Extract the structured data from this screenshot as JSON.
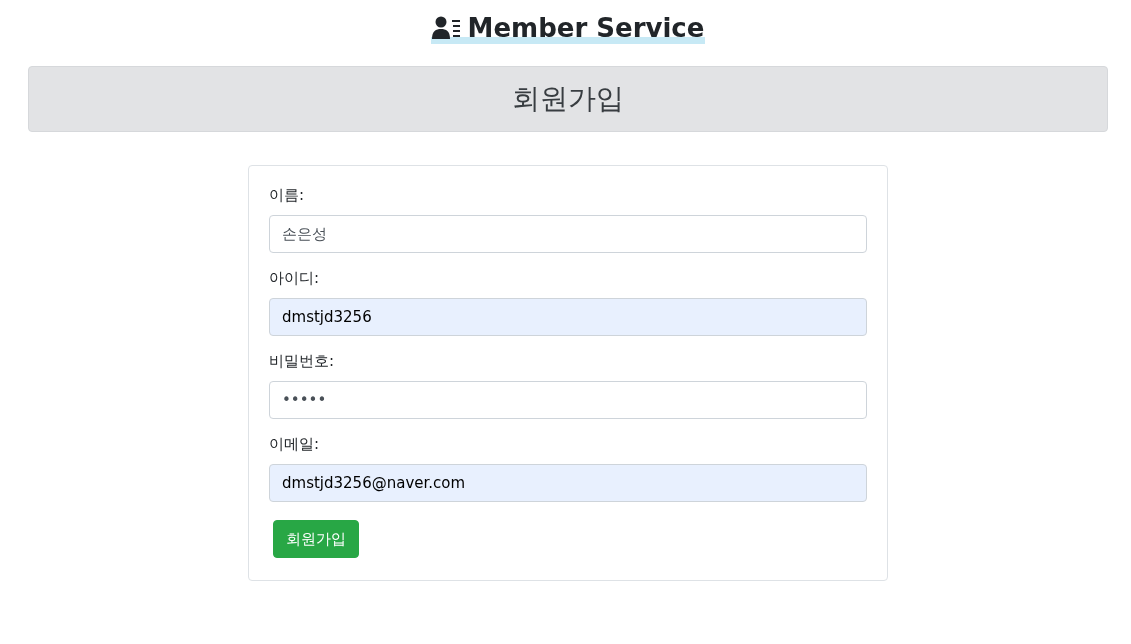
{
  "header": {
    "title": "Member Service"
  },
  "banner": {
    "title": "회원가입"
  },
  "form": {
    "fields": [
      {
        "label": "이름:",
        "value": "손은성",
        "autofilled": false
      },
      {
        "label": "아이디:",
        "value": "dmstjd3256",
        "autofilled": true
      },
      {
        "label": "비밀번호:",
        "value": "•••••",
        "autofilled": false
      },
      {
        "label": "이메일:",
        "value": "dmstjd3256@naver.com",
        "autofilled": true
      }
    ],
    "submit": "회원가입"
  }
}
